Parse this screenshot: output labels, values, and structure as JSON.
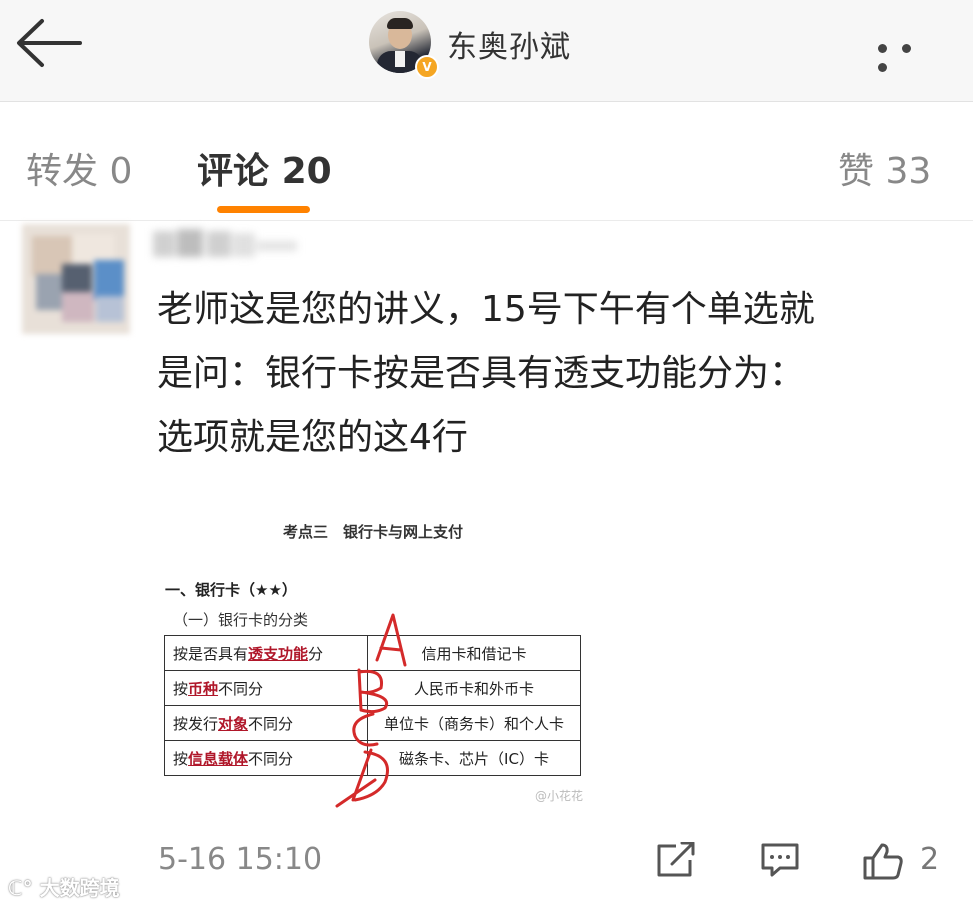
{
  "header": {
    "username": "东奥孙斌",
    "verified_badge": "V",
    "icons": {
      "back": "back-arrow-icon",
      "more": "more-dots-icon"
    }
  },
  "tabs": [
    {
      "label": "转发",
      "count": "0",
      "active": false
    },
    {
      "label": "评论",
      "count": "20",
      "active": true
    },
    {
      "label": "赞",
      "count": "33",
      "active": false
    }
  ],
  "accent_color": "#ff8200",
  "comment": {
    "lines": [
      "老师这是您的讲义，15号下午有个单选就",
      "是问：银行卡按是否具有透支功能分为：",
      "选项就是您的这4行"
    ],
    "timestamp": "5-16 15:10",
    "like_count": "2",
    "actions": [
      "share-icon",
      "reply-comment-icon",
      "thumbs-up-icon"
    ]
  },
  "attached_image": {
    "title": "考点三　银行卡与网上支付",
    "heading": "一、银行卡（★★）",
    "subheading": "（一）银行卡的分类",
    "rows": [
      {
        "pre": "按是否具有",
        "hl": "透支功能",
        "post": "分",
        "right": "信用卡和借记卡"
      },
      {
        "pre": "按",
        "hl": "币种",
        "post": "不同分",
        "right": "人民币卡和外币卡"
      },
      {
        "pre": "按发行",
        "hl": "对象",
        "post": "不同分",
        "right": "单位卡（商务卡）和个人卡"
      },
      {
        "pre": "按",
        "hl": "信息载体",
        "post": "不同分",
        "right": "磁条卡、芯片（IC）卡"
      }
    ],
    "handwritten": [
      "A",
      "B",
      "C",
      "D"
    ],
    "watermark": "@小花花"
  },
  "bottom_watermark": "大数跨境"
}
